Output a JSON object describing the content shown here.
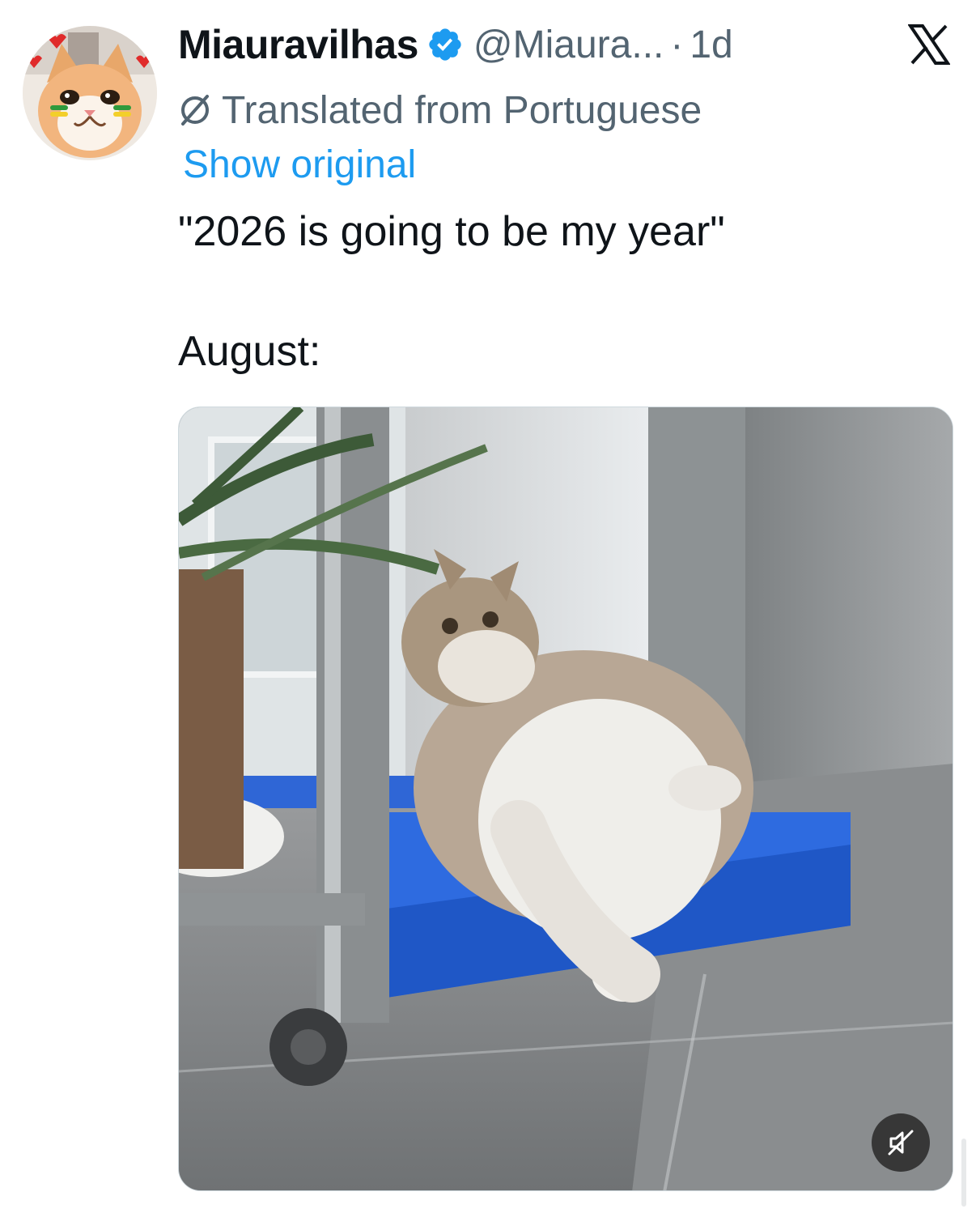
{
  "post": {
    "display_name": "Miauravilhas",
    "handle": "@Miaura...",
    "separator": "·",
    "time": "1d",
    "verified": true,
    "translation_note": "Translated from Portuguese",
    "show_original_label": "Show original",
    "text_line_1": "\"2026 is going to be my year\"",
    "text_line_2": "August:"
  },
  "colors": {
    "accent": "#1d9bf0",
    "text_primary": "#0f1419",
    "text_secondary": "#536471"
  },
  "icons": {
    "verified": "verified-badge-icon",
    "brand": "x-logo-icon",
    "translate": "translate-icon",
    "mute": "muted-speaker-icon"
  }
}
